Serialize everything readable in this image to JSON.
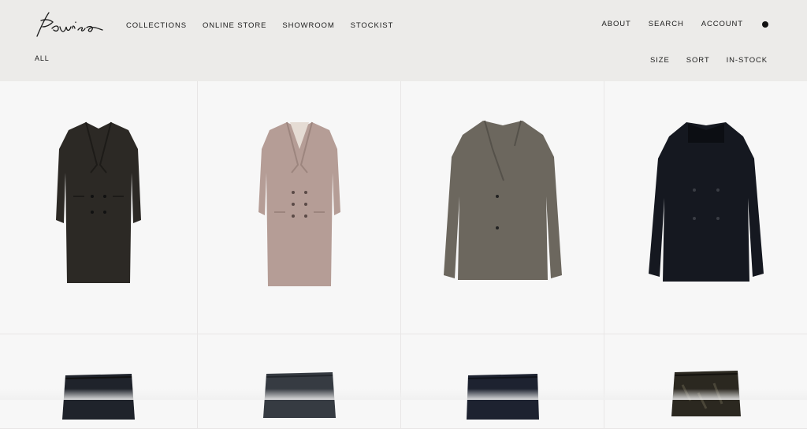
{
  "brand": {
    "name": "Kaonisa"
  },
  "nav_left": [
    "COLLECTIONS",
    "ONLINE STORE",
    "SHOWROOM",
    "STOCKIST"
  ],
  "nav_right": [
    "ABOUT",
    "SEARCH",
    "ACCOUNT"
  ],
  "filter_all": "ALL",
  "filters": [
    "SIZE",
    "SORT",
    "IN-STOCK"
  ],
  "products": [
    {
      "item": "coat",
      "color": "#2c2925"
    },
    {
      "item": "coat",
      "color": "#b59d96"
    },
    {
      "item": "jacket",
      "color": "#6c675e"
    },
    {
      "item": "jacket",
      "color": "#151820"
    },
    {
      "item": "trousers",
      "color": "#1f232b"
    },
    {
      "item": "trousers",
      "color": "#363b42"
    },
    {
      "item": "trousers",
      "color": "#1d2230"
    },
    {
      "item": "trousers",
      "color": "#2b2820"
    }
  ]
}
